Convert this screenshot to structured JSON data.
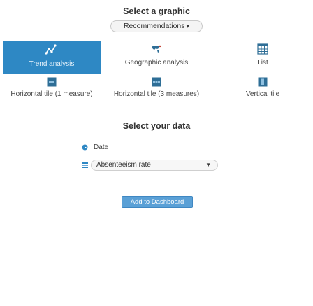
{
  "header": {
    "select_graphic": "Select a graphic",
    "select_data": "Select your data"
  },
  "recommendations": {
    "value": "Recommendations",
    "arrow": "▾"
  },
  "tiles": [
    {
      "label": "Trend analysis",
      "icon": "trend-icon",
      "selected": true
    },
    {
      "label": "Geographic analysis",
      "icon": "map-icon",
      "selected": false
    },
    {
      "label": "List",
      "icon": "list-icon",
      "selected": false
    },
    {
      "label": "Horizontal tile (1 measure)",
      "icon": "tile-1-icon",
      "selected": false
    },
    {
      "label": "Horizontal tile (3 measures)",
      "icon": "tile-3-icon",
      "selected": false
    },
    {
      "label": "Vertical tile",
      "icon": "vertical-tile-icon",
      "selected": false
    }
  ],
  "data": {
    "date_label": "Date",
    "measure_value": "Absenteeism rate",
    "measure_arrow": "▼"
  },
  "actions": {
    "add_to_dashboard": "Add to Dashboard"
  },
  "colors": {
    "accent": "#2e88c4",
    "button": "#5aa0d6"
  }
}
